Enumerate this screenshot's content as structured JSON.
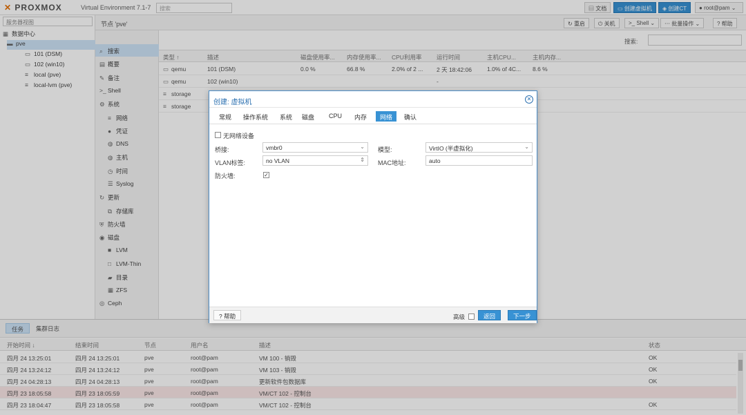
{
  "topbar": {
    "logo": "PROXMOX",
    "version": "Virtual Environment 7.1-7",
    "search_placeholder": "搜索",
    "docs": "文档",
    "create_vm": "创建虚拟机",
    "create_ct": "创建CT",
    "user": "root@pam"
  },
  "tree": {
    "view": "服务器视图",
    "datacenter": "数据中心",
    "node": "pve",
    "items": [
      "101 (DSM)",
      "102 (win10)",
      "local (pve)",
      "local-lvm (pve)"
    ]
  },
  "node_header": {
    "title": "节点 'pve'",
    "reboot": "重启",
    "shutdown": "关机",
    "shell": "Shell",
    "bulk": "批量操作",
    "help": "帮助"
  },
  "node_menu": [
    {
      "label": "搜索",
      "icon": "search-icon",
      "sub": false,
      "sel": true
    },
    {
      "label": "概要",
      "icon": "summary-icon",
      "sub": false
    },
    {
      "label": "备注",
      "icon": "notes-icon",
      "sub": false
    },
    {
      "label": "Shell",
      "icon": "terminal-icon",
      "sub": false
    },
    {
      "label": "系统",
      "icon": "gear-icon",
      "sub": false
    },
    {
      "label": "网络",
      "icon": "network-icon",
      "sub": true
    },
    {
      "label": "凭证",
      "icon": "certificate-icon",
      "sub": true
    },
    {
      "label": "DNS",
      "icon": "globe-icon",
      "sub": true
    },
    {
      "label": "主机",
      "icon": "host-icon",
      "sub": true
    },
    {
      "label": "时间",
      "icon": "clock-icon",
      "sub": true
    },
    {
      "label": "Syslog",
      "icon": "list-icon",
      "sub": true
    },
    {
      "label": "更新",
      "icon": "refresh-icon",
      "sub": false
    },
    {
      "label": "存储库",
      "icon": "repository-icon",
      "sub": true
    },
    {
      "label": "防火墙",
      "icon": "shield-icon",
      "sub": false
    },
    {
      "label": "磁盘",
      "icon": "disk-icon",
      "sub": false
    },
    {
      "label": "LVM",
      "icon": "lvm-icon",
      "sub": true
    },
    {
      "label": "LVM-Thin",
      "icon": "lvm-thin-icon",
      "sub": true
    },
    {
      "label": "目录",
      "icon": "folder-icon",
      "sub": true
    },
    {
      "label": "ZFS",
      "icon": "zfs-icon",
      "sub": true
    },
    {
      "label": "Ceph",
      "icon": "ceph-icon",
      "sub": false
    }
  ],
  "search": {
    "label": "搜索:"
  },
  "grid": {
    "headers": [
      "类型 ↑",
      "描述",
      "磁盘使用率...",
      "内存使用率...",
      "CPU利用率",
      "运行时间",
      "主机CPU...",
      "主机内存..."
    ],
    "rows": [
      [
        "qemu",
        "101 (DSM)",
        "0.0 %",
        "66.8 %",
        "2.0% of 2 ...",
        "2 天 18:42:06",
        "1.0% of 4C...",
        "8.6 %"
      ],
      [
        "qemu",
        "102 (win10)",
        "",
        "",
        "",
        "-",
        "",
        ""
      ],
      [
        "storage",
        "",
        "",
        "",
        "",
        "",
        "",
        ""
      ],
      [
        "storage",
        "",
        "",
        "",
        "",
        "",
        "",
        ""
      ]
    ]
  },
  "tasks": {
    "tab_tasks": "任务",
    "tab_cluster": "集群日志",
    "headers": [
      "开始时间 ↓",
      "结束时间",
      "节点",
      "用户名",
      "描述",
      "状态"
    ],
    "rows": [
      [
        "四月 24 13:25:01",
        "四月 24 13:25:01",
        "pve",
        "root@pam",
        "VM 100 - 销毁",
        "OK"
      ],
      [
        "四月 24 13:24:12",
        "四月 24 13:24:12",
        "pve",
        "root@pam",
        "VM 103 - 销毁",
        "OK"
      ],
      [
        "四月 24 04:28:13",
        "四月 24 04:28:13",
        "pve",
        "root@pam",
        "更新软件包数据库",
        "OK"
      ],
      [
        "四月 23 18:05:58",
        "四月 23 18:05:59",
        "pve",
        "root@pam",
        "VM/CT 102 - 控制台",
        ""
      ],
      [
        "四月 23 18:04:47",
        "四月 23 18:05:58",
        "pve",
        "root@pam",
        "VM/CT 102 - 控制台",
        "OK"
      ]
    ]
  },
  "dialog": {
    "title": "创建: 虚拟机",
    "tabs": [
      "常规",
      "操作系统",
      "系统",
      "磁盘",
      "CPU",
      "内存",
      "网络",
      "确认"
    ],
    "no_network": "无网络设备",
    "bridge_label": "桥接:",
    "bridge_value": "vmbr0",
    "vlan_label": "VLAN标签:",
    "vlan_value": "no VLAN",
    "firewall_label": "防火墙:",
    "model_label": "模型:",
    "model_value": "VirtIO (半虚拟化)",
    "mac_label": "MAC地址:",
    "mac_value": "auto",
    "help": "帮助",
    "advanced": "高级",
    "back": "返回",
    "next": "下一步"
  },
  "colors": {
    "accent": "#3892d4",
    "selection": "#cde3f7",
    "error_row": "#fbe7e7",
    "logo_x": "#e57000"
  }
}
